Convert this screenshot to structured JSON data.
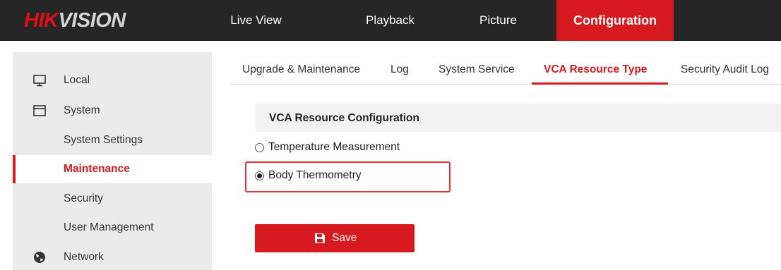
{
  "brand": {
    "logo_part1": "HIK",
    "logo_part2": "VISION"
  },
  "nav": {
    "items": [
      {
        "label": "Live View"
      },
      {
        "label": "Playback"
      },
      {
        "label": "Picture"
      },
      {
        "label": "Configuration",
        "active": true
      }
    ]
  },
  "sidebar": {
    "items": [
      {
        "label": "Local",
        "icon": "monitor-icon"
      },
      {
        "label": "System",
        "icon": "window-icon"
      },
      {
        "label": "System Settings"
      },
      {
        "label": "Maintenance",
        "active": true
      },
      {
        "label": "Security"
      },
      {
        "label": "User Management"
      },
      {
        "label": "Network",
        "icon": "globe-icon"
      }
    ]
  },
  "subtabs": {
    "items": [
      {
        "label": "Upgrade & Maintenance"
      },
      {
        "label": "Log"
      },
      {
        "label": "System Service"
      },
      {
        "label": "VCA Resource Type",
        "active": true
      },
      {
        "label": "Security Audit Log"
      }
    ]
  },
  "section": {
    "title": "VCA Resource Configuration",
    "options": [
      {
        "label": "Temperature Measurement",
        "checked": false
      },
      {
        "label": "Body Thermometry",
        "checked": true
      }
    ]
  },
  "save": {
    "label": "Save",
    "icon": "save-icon"
  },
  "colors": {
    "accent": "#d71920",
    "topbar": "#262626",
    "sidebar": "#ebebeb",
    "highlight": "#e8323a"
  }
}
